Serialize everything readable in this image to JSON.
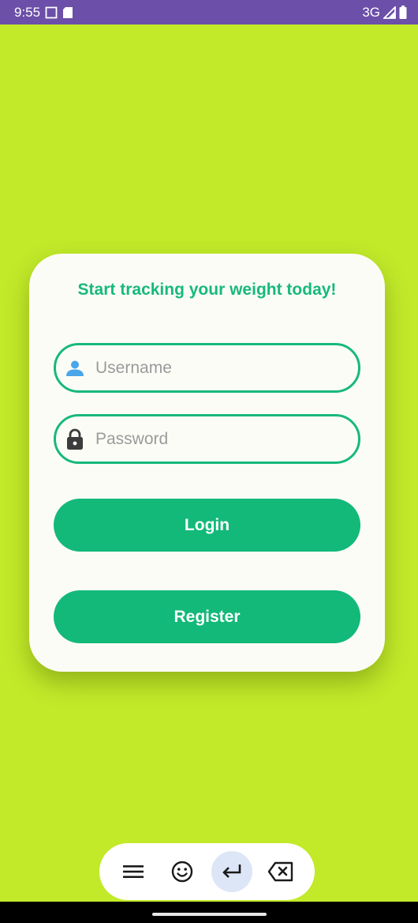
{
  "status_bar": {
    "time": "9:55",
    "network": "3G"
  },
  "card": {
    "title": "Start tracking your weight today!",
    "username": {
      "placeholder": "Username",
      "value": "",
      "icon": "person-icon"
    },
    "password": {
      "placeholder": "Password",
      "value": "",
      "icon": "lock-icon"
    },
    "login_label": "Login",
    "register_label": "Register"
  },
  "keyboard_toolbar": {
    "items": [
      "menu-icon",
      "emoji-icon",
      "enter-icon",
      "backspace-icon"
    ],
    "active": "enter-icon"
  },
  "colors": {
    "background": "#c2ea29",
    "accent": "#17b97a",
    "status_bar": "#6b4fa8",
    "card": "#fcfcf7"
  }
}
